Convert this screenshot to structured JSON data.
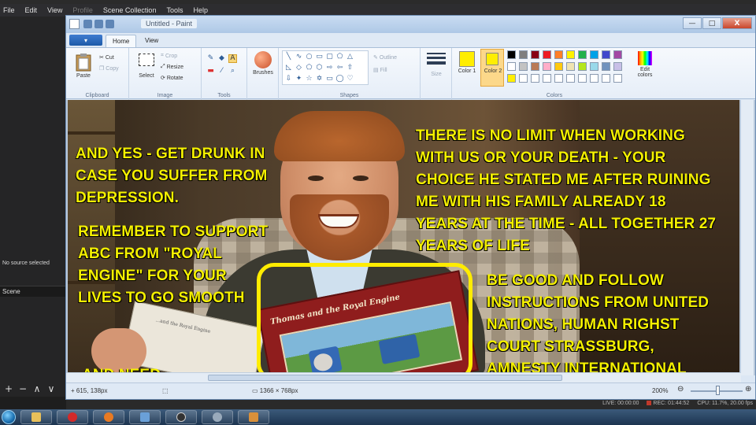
{
  "obs": {
    "menu": [
      "File",
      "Edit",
      "View",
      "Profile",
      "Scene Collection",
      "Tools",
      "Help"
    ],
    "no_source_label": "No source selected",
    "scene_header": "Scene",
    "controls": [
      "+",
      "−",
      "∧",
      "∨"
    ],
    "status": {
      "live": "LIVE: 00:00:00",
      "rec": "REC: 01:44:52",
      "cpu": "CPU: 11.7%, 20.00 fps"
    }
  },
  "paint": {
    "title": "Untitled - Paint",
    "tabs": {
      "home": "Home",
      "view": "View"
    },
    "file_button": "▾",
    "window_buttons": {
      "minimize": "—",
      "maximize": "□",
      "close": "X"
    },
    "clipboard": {
      "paste": "Paste",
      "cut": "Cut",
      "copy": "Copy",
      "label": "Clipboard"
    },
    "image": {
      "select": "Select",
      "crop": "Crop",
      "resize": "Resize",
      "rotate": "Rotate",
      "label": "Image"
    },
    "tools": {
      "label": "Tools"
    },
    "brushes": {
      "label": "Brushes"
    },
    "shapes": {
      "outline": "Outline",
      "fill": "Fill",
      "label": "Shapes"
    },
    "size": {
      "label": "Size"
    },
    "colors": {
      "color1": "Color 1",
      "color2": "Color 2",
      "edit": "Edit colors",
      "label": "Colors",
      "color1_value": "#ffee00",
      "color2_value": "#ffee00",
      "palette_row1": [
        "#000000",
        "#7f7f7f",
        "#880015",
        "#ed1c24",
        "#ff7f27",
        "#fff200",
        "#22b14c",
        "#00a2e8",
        "#3f48cc",
        "#a349a4"
      ],
      "palette_row2": [
        "#ffffff",
        "#c3c3c3",
        "#b97a57",
        "#ffaec9",
        "#ffc90e",
        "#efe4b0",
        "#b5e61d",
        "#99d9ea",
        "#7092be",
        "#c8bfe7"
      ],
      "palette_row3": [
        "#ffee00",
        "#ffffff",
        "#ffffff",
        "#ffffff",
        "#ffffff",
        "#ffffff",
        "#ffffff",
        "#ffffff",
        "#ffffff",
        "#ffffff"
      ]
    },
    "status": {
      "cursor_pos": "615, 138px",
      "image_size": "1366 × 768px",
      "zoom": "200%"
    }
  },
  "meme": {
    "text_left_top": [
      "AND YES - GET DRUNK IN",
      "CASE YOU SUFFER FROM",
      "DEPRESSION."
    ],
    "text_left_mid": [
      "REMEMBER TO SUPPORT",
      "ABC FROM \"ROYAL",
      "ENGINE\" FOR YOUR",
      "LIVES TO GO SMOOTH"
    ],
    "text_left_bottom": "AND NEED",
    "text_right_top": [
      "THERE IS NO LIMIT WHEN WORKING",
      "WITH US OR YOUR DEATH  - YOUR",
      "CHOICE HE STATED ME AFTER RUINING",
      "ME WITH HIS FAMILY ALREADY 18",
      "YEARS AT THE TIME - ALL TOGETHER 27",
      "YEARS OF LIFE"
    ],
    "text_right_bottom": [
      "BE GOOD AND FOLLOW",
      "INSTRUCTIONS FROM UNITED",
      "NATIONS, HUMAN RIGHST",
      "COURT STRASSBURG,",
      "AMNESTY INTERNATIONAL"
    ],
    "book_title": "Thomas and the Royal Engine",
    "book_left_text": "...and the Royal Engine"
  }
}
